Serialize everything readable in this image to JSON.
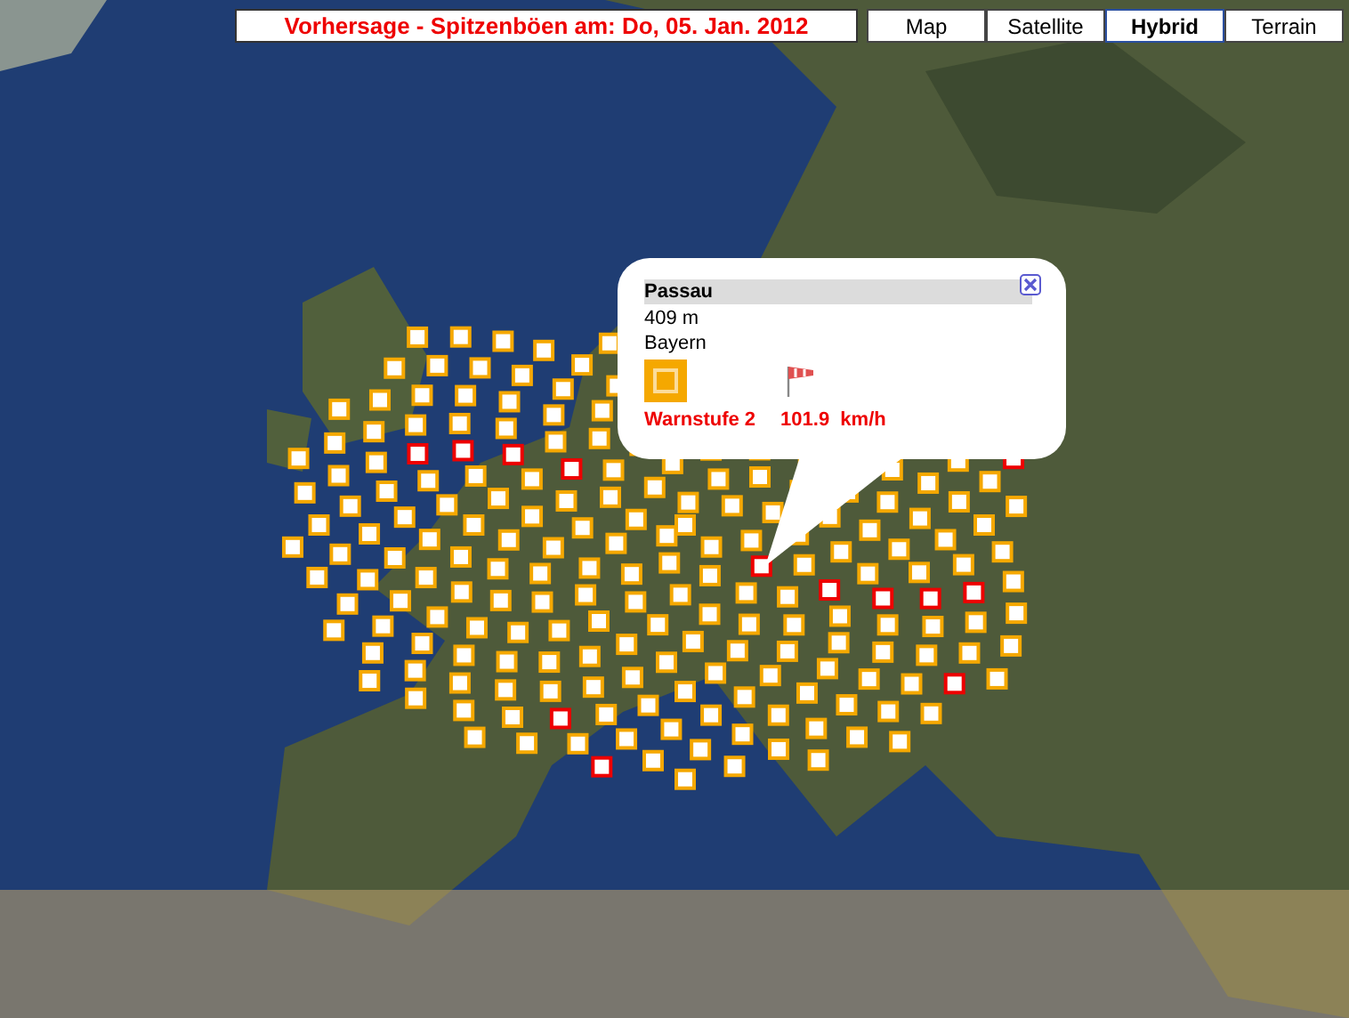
{
  "title": "Vorhersage - Spitzenböen am: Do, 05. Jan. 2012",
  "map_types": [
    {
      "label": "Map",
      "selected": false
    },
    {
      "label": "Satellite",
      "selected": false
    },
    {
      "label": "Hybrid",
      "selected": true
    },
    {
      "label": "Terrain",
      "selected": false
    }
  ],
  "popup": {
    "station": "Passau",
    "altitude": "409 m",
    "region": "Bayern",
    "warning": "Warnstufe 2",
    "gust": "101.9  km/h",
    "color": "#f5a800"
  }
}
